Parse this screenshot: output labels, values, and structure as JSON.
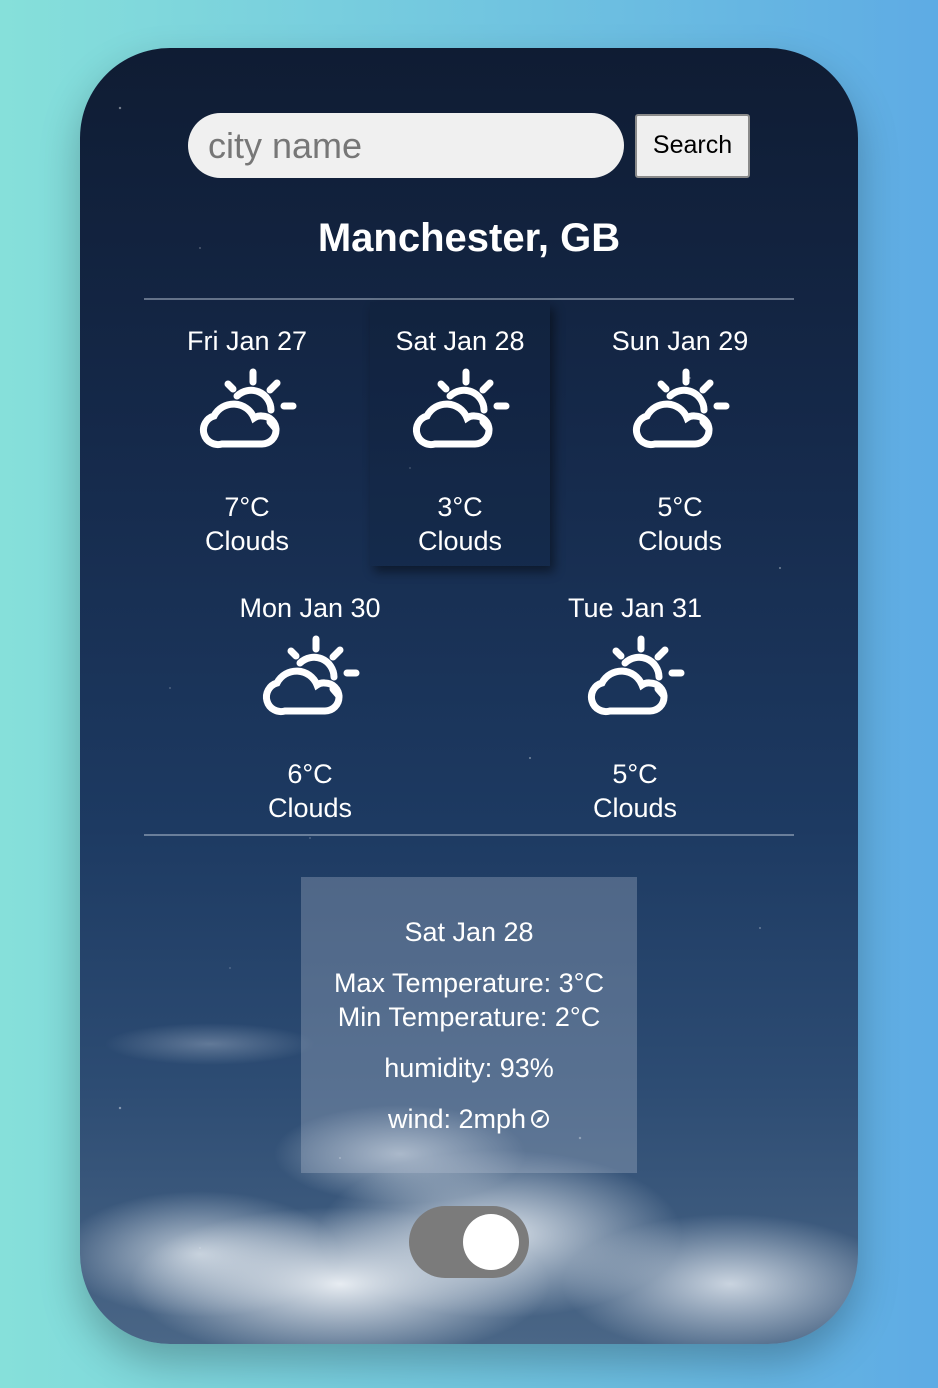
{
  "search": {
    "placeholder": "city name",
    "value": "",
    "button_label": "Search"
  },
  "location": {
    "title": "Manchester, GB"
  },
  "forecast": [
    {
      "date": "Fri Jan 27",
      "temp": "7°C",
      "condition": "Clouds",
      "icon": "partly-cloudy-icon",
      "selected": false
    },
    {
      "date": "Sat Jan 28",
      "temp": "3°C",
      "condition": "Clouds",
      "icon": "partly-cloudy-icon",
      "selected": true
    },
    {
      "date": "Sun Jan 29",
      "temp": "5°C",
      "condition": "Clouds",
      "icon": "partly-cloudy-icon",
      "selected": false
    },
    {
      "date": "Mon Jan 30",
      "temp": "6°C",
      "condition": "Clouds",
      "icon": "partly-cloudy-icon",
      "selected": false
    },
    {
      "date": "Tue Jan 31",
      "temp": "5°C",
      "condition": "Clouds",
      "icon": "partly-cloudy-icon",
      "selected": false
    }
  ],
  "details": {
    "date": "Sat Jan 28",
    "max_temp": "Max Temperature: 3°C",
    "min_temp": "Min Temperature: 2°C",
    "humidity": "humidity: 93%",
    "wind": "wind: 2mph",
    "wind_icon": "wind-direction-icon"
  },
  "toggle": {
    "state": "on"
  },
  "colors": {
    "page_gradient_start": "#86e0da",
    "page_gradient_end": "#5eabe4",
    "card_background": "#15294a",
    "text": "#ffffff",
    "toggle_track": "#7b7b7b"
  }
}
